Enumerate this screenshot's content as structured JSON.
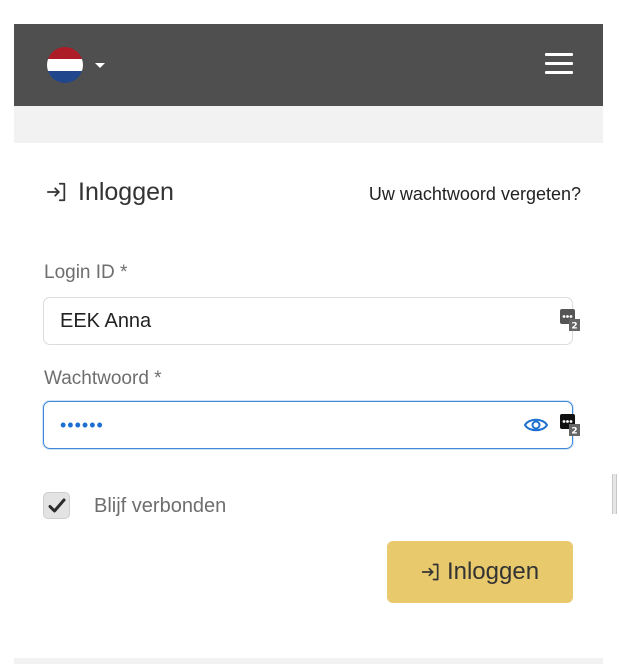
{
  "navbar": {
    "language_flag": "netherlands-flag-icon",
    "language_caret": "caret-down-icon",
    "menu_icon": "hamburger-icon",
    "background_color": "#4f4f4f"
  },
  "login_card": {
    "title_icon": "sign-in-icon",
    "title": "Inloggen",
    "forgot_password_link": "Uw wachtwoord vergeten?",
    "login_id": {
      "label": "Login ID *",
      "value": "EEK Anna",
      "password_manager_badge": "2"
    },
    "password": {
      "label": "Wachtwoord *",
      "value": "••••••",
      "reveal_icon": "eye-icon",
      "password_manager_badge": "2"
    },
    "remember_me": {
      "label": "Blijf verbonden",
      "checked": true
    },
    "submit_button": {
      "icon": "sign-in-icon",
      "label": "Inloggen",
      "color": "#e8c96b"
    }
  },
  "colors": {
    "focus_border": "#3f8ad8",
    "password_text": "#1d6fd1",
    "page_background": "#f2f2f2"
  }
}
